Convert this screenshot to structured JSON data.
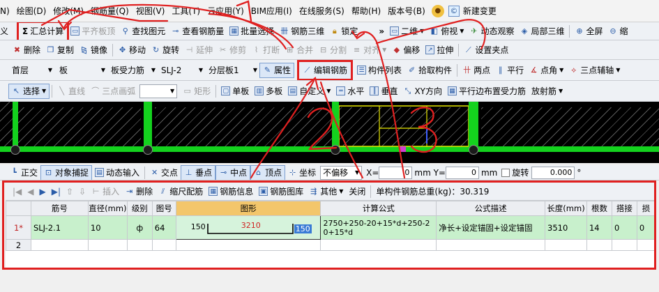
{
  "menu": [
    "N)",
    "绘图(D)",
    "修改(M)",
    "钢筋量(Q)",
    "视图(V)",
    "工具(T)",
    "云应用(Y)",
    "BIM应用(I)",
    "在线服务(S)",
    "帮助(H)",
    "版本号(B)",
    "新建变更"
  ],
  "toolbar1": {
    "left_cut": "义",
    "sum_calc": "汇总计算",
    "flat_top": "平齐板顶",
    "find_element": "查找图元",
    "view_rebar": "查看钢筋量",
    "batch_select": "批量选择",
    "rebar_3d": "钢筋三维",
    "lock": "锁定",
    "view_2d": "二维",
    "top_view": "俯视",
    "dynamic_view": "动态观察",
    "local_3d": "局部三维",
    "full_screen": "全屏",
    "zoom_cut": "缩"
  },
  "toolbar2": [
    "删除",
    "复制",
    "镜像",
    "移动",
    "旋转",
    "延伸",
    "修剪",
    "打断",
    "合并",
    "分割",
    "对齐",
    "偏移",
    "拉伸",
    "设置夹点"
  ],
  "toolbar3": {
    "floor": "首层",
    "type": "板",
    "sub_type": "板受力筋",
    "name": "SLJ-2",
    "layer": "分层板1",
    "properties": "属性",
    "edit_rebar": "编辑钢筋",
    "element_list": "构件列表",
    "pick_element": "拾取构件",
    "two_points": "两点",
    "parallel": "平行",
    "point_angle": "点角",
    "three_point_axis": "三点辅轴"
  },
  "toolbar4": {
    "select": "选择",
    "line": "直线",
    "arc": "三点画弧",
    "rect": "矩形",
    "single_board": "单板",
    "multi_board": "多板",
    "custom": "自定义",
    "horizontal": "水平",
    "vertical": "垂直",
    "xy_dir": "XY方向",
    "parallel_edge": "平行边布置受力筋",
    "radial": "放射筋"
  },
  "statusbar": {
    "ortho": "正交",
    "snap": "对象捕捉",
    "dyn_input": "动态输入",
    "intersection": "交点",
    "perpendicular": "垂点",
    "midpoint": "中点",
    "vertex": "顶点",
    "coord": "坐标",
    "offset": "不偏移",
    "x_label": "X=",
    "x_value": "0",
    "y_label": "mm Y=",
    "y_value": "0",
    "unit": "mm",
    "rotate": "旋转",
    "angle": "0.000",
    "deg": "°"
  },
  "editor": {
    "insert": "插入",
    "delete": "删除",
    "scale": "缩尺配筋",
    "rebar_info": "钢筋信息",
    "rebar_lib": "钢筋图库",
    "other": "其他",
    "close": "关闭",
    "total_label": "单构件钢筋总重(kg)：30.319",
    "columns": [
      "筋号",
      "直径(mm)",
      "级别",
      "图号",
      "图形",
      "计算公式",
      "公式描述",
      "长度(mm)",
      "根数",
      "搭接",
      "损"
    ],
    "rows": [
      {
        "num": "1*",
        "name": "SLJ-2.1",
        "diameter": "10",
        "grade": "ф",
        "fig_no": "64",
        "shape_left": "150",
        "shape_mid": "3210",
        "shape_right": "150",
        "formula": "2750+250-20+15*d+250-20+15*d",
        "desc": "净长+设定锚固+设定锚固",
        "length": "3510",
        "count": "14",
        "lap": "0",
        "loss": "0"
      },
      {
        "num": "2"
      }
    ]
  },
  "annotations": {
    "n1": "1",
    "n2": "2",
    "n3": "3"
  },
  "colors": {
    "highlight": "#e02020",
    "beam": "#14d21e",
    "row_sel": "#c8f0cc",
    "header_active": "#f3c66b"
  }
}
